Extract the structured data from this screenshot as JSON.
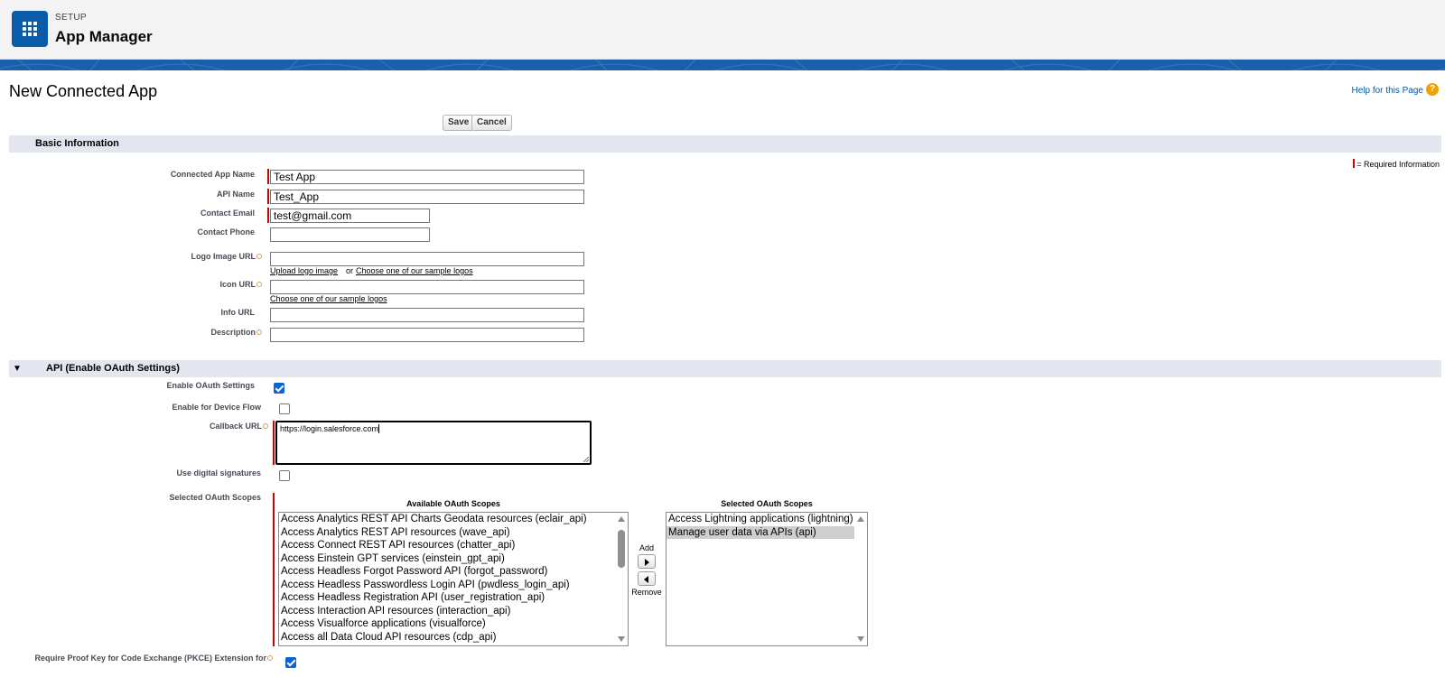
{
  "header": {
    "kicker": "SETUP",
    "title": "App Manager",
    "icon": "app-launcher-grid-icon",
    "brand_color": "#1b5faa"
  },
  "page": {
    "title": "New Connected App",
    "help_link": "Help for this Page",
    "help_icon": "?"
  },
  "buttons": {
    "save": "Save",
    "cancel": "Cancel"
  },
  "basic_info": {
    "section_title": "Basic Information",
    "required_legend": "= Required Information",
    "fields": {
      "connected_app_name": {
        "label": "Connected App Name",
        "value": "Test App"
      },
      "api_name": {
        "label": "API Name",
        "value": "Test_App"
      },
      "contact_email": {
        "label": "Contact Email",
        "value": "test@gmail.com"
      },
      "contact_phone": {
        "label": "Contact Phone",
        "value": ""
      },
      "logo_image_url": {
        "label": "Logo Image URL",
        "value": ""
      },
      "icon_url": {
        "label": "Icon URL",
        "value": ""
      },
      "info_url": {
        "label": "Info URL",
        "value": ""
      },
      "description": {
        "label": "Description",
        "value": ""
      }
    },
    "logo_links": {
      "upload": "Upload logo image",
      "or": "or",
      "sample": "Choose one of our sample logos"
    },
    "icon_link": "Choose one of our sample logos"
  },
  "api": {
    "section_title": "API (Enable OAuth Settings)",
    "twisty": "▼",
    "enable_oauth": {
      "label": "Enable OAuth Settings",
      "checked": true
    },
    "device_flow": {
      "label": "Enable for Device Flow",
      "checked": false
    },
    "callback_url": {
      "label": "Callback URL",
      "value": "https://login.salesforce.com"
    },
    "digital_signatures": {
      "label": "Use digital signatures",
      "checked": false
    },
    "scopes_label": "Selected OAuth Scopes",
    "available_title": "Available OAuth Scopes",
    "selected_title": "Selected OAuth Scopes",
    "add_label": "Add",
    "remove_label": "Remove",
    "available_scopes": [
      "Access Analytics REST API Charts Geodata resources (eclair_api)",
      "Access Analytics REST API resources (wave_api)",
      "Access Connect REST API resources (chatter_api)",
      "Access Einstein GPT services (einstein_gpt_api)",
      "Access Headless Forgot Password API (forgot_password)",
      "Access Headless Passwordless Login API (pwdless_login_api)",
      "Access Headless Registration API (user_registration_api)",
      "Access Interaction API resources (interaction_api)",
      "Access Visualforce applications (visualforce)",
      "Access all Data Cloud API resources (cdp_api)"
    ],
    "selected_scopes": [
      "Access Lightning applications (lightning)",
      "Manage user data via APIs (api)"
    ],
    "pkce": {
      "label": "Require Proof Key for Code Exchange (PKCE) Extension for",
      "checked": true
    }
  }
}
